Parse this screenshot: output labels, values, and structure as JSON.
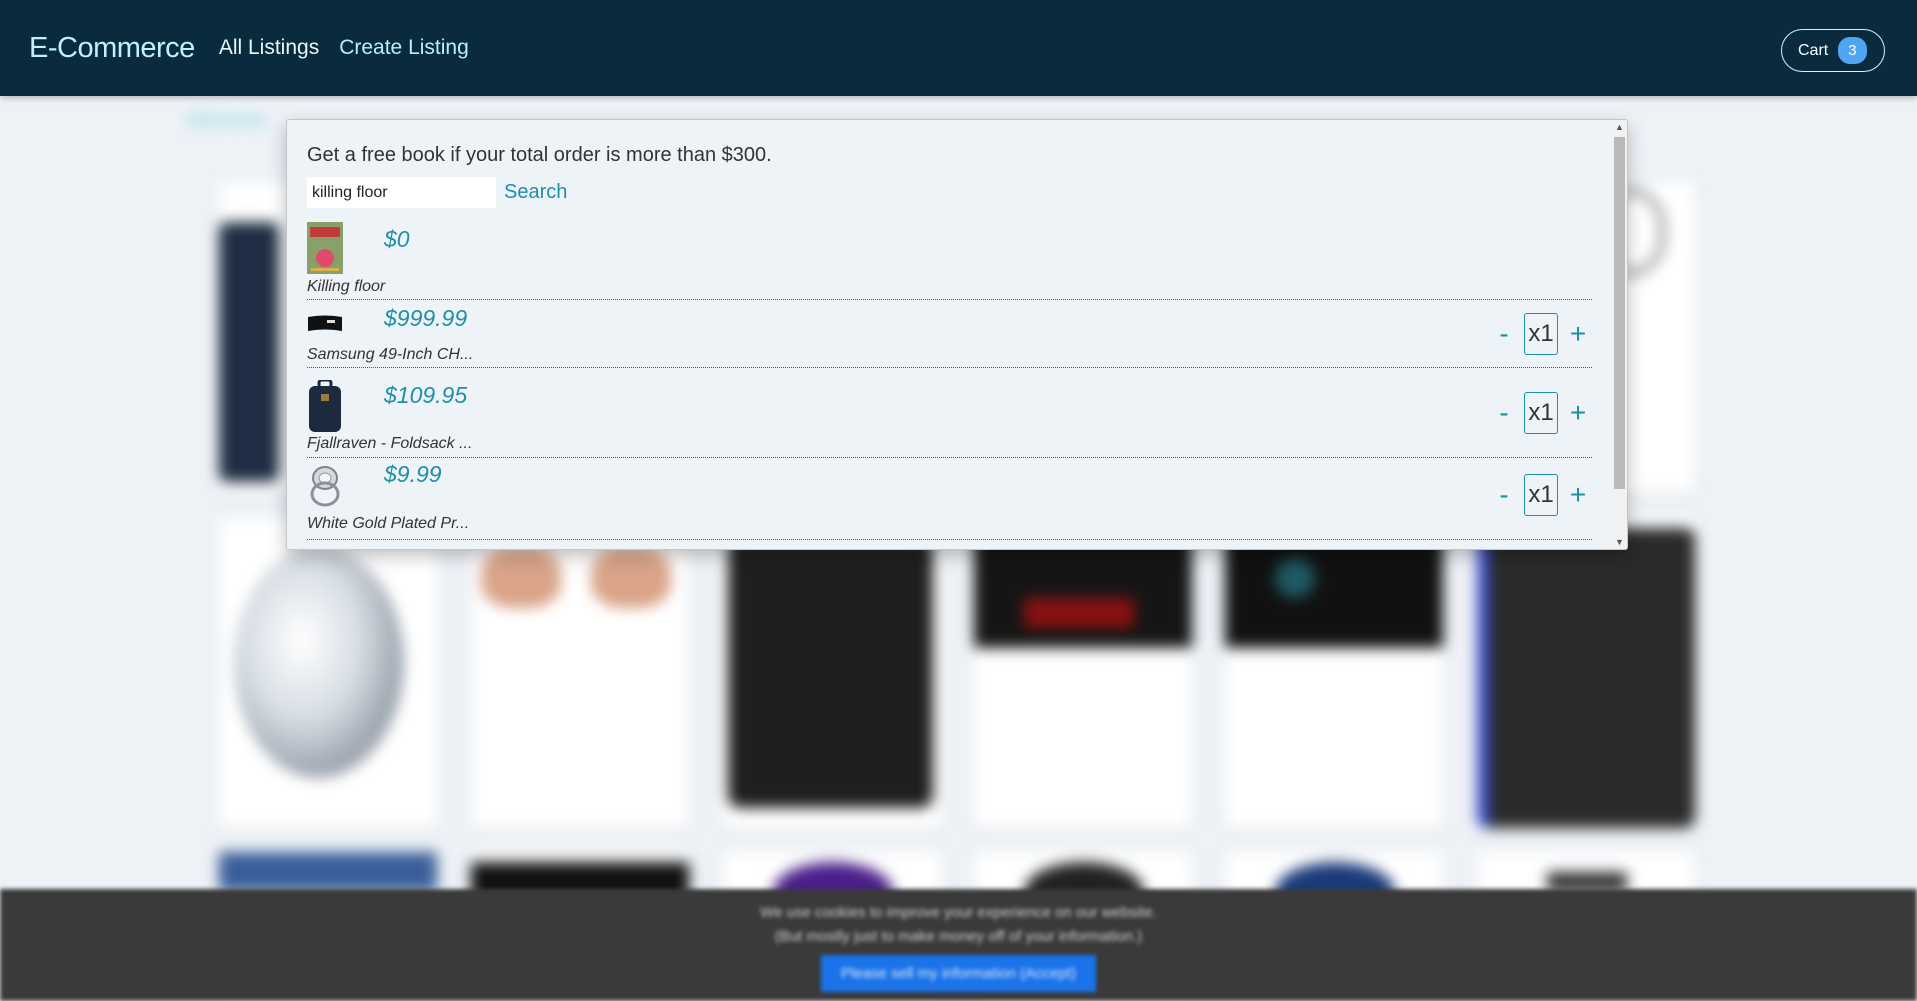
{
  "navbar": {
    "brand": "E-Commerce",
    "links": [
      "All Listings",
      "Create Listing"
    ],
    "cart_label": "Cart",
    "cart_count": "3"
  },
  "background": {
    "category_label": "Electronics"
  },
  "popover": {
    "promo_text": "Get a free book if your total order is more than $300.",
    "search": {
      "value": "killing floor",
      "button_label": "Search"
    },
    "items": [
      {
        "price": "$0",
        "name": "Killing floor",
        "icon": "book-cover-icon"
      },
      {
        "price": "$999.99",
        "name": "Samsung 49-Inch CH...",
        "icon": "monitor-icon",
        "qty": "x1",
        "minus": "-",
        "plus": "+"
      },
      {
        "price": "$109.95",
        "name": "Fjallraven - Foldsack ...",
        "icon": "backpack-icon",
        "qty": "x1",
        "minus": "-",
        "plus": "+"
      },
      {
        "price": "$9.99",
        "name": "White Gold Plated Pr...",
        "icon": "ring-icon",
        "qty": "x1",
        "minus": "-",
        "plus": "+"
      }
    ]
  },
  "cookie_banner": {
    "line1": "We use cookies to improve your experience on our website.",
    "line2": "(But mostly just to make money off of your information.)",
    "accept_label": "Please sell my information (Accept)"
  },
  "colors": {
    "navbar_bg": "#0a2b3d",
    "accent": "#1f8fa6",
    "badge": "#4fa5ef",
    "cookie_button": "#1a73e8"
  }
}
